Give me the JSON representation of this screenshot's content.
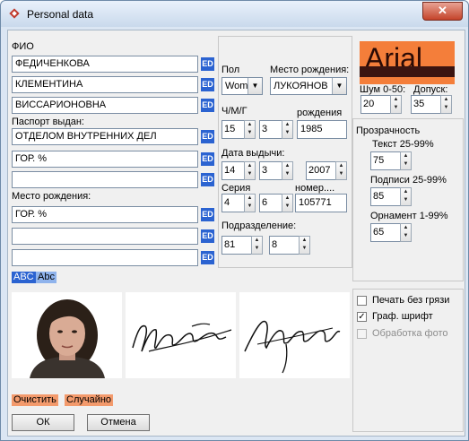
{
  "window": {
    "title": "Personal data",
    "close_label": "✕"
  },
  "fio": {
    "label": "ФИО",
    "surname": "ФЕДИЧЕНКОВА",
    "name": "КЛЕМЕНТИНА",
    "patronymic": "ВИССАРИОНОВНА",
    "ed_label": "ED"
  },
  "passport": {
    "label": "Паспорт выдан:",
    "line1": "ОТДЕЛОМ ВНУТРЕННИХ ДЕЛ",
    "line2": "ГОР. %",
    "line3": ""
  },
  "birthplace": {
    "label": "Место рождения:",
    "line1": "ГОР. %",
    "line2": "",
    "line3": ""
  },
  "case_buttons": {
    "upper": "ABC",
    "mixed": "Abc"
  },
  "middle": {
    "sex_label": "Пол",
    "sex_value": "Wom",
    "birthplace_label": "Место рождения:",
    "birthplace_value": "ЛУКОЯНОВ",
    "dmy_label": "Ч/М/Г",
    "birth_label": "рождения",
    "birth_day": "15",
    "birth_month": "3",
    "birth_year": "1985",
    "issue_label": "Дата выдычи:",
    "issue_day": "14",
    "issue_month": "3",
    "issue_year": "2007",
    "series_label": "Серия",
    "number_label": "номер....",
    "series_1": "4",
    "series_2": "6",
    "number": "105771",
    "division_label": "Подразделение:",
    "division_1": "81",
    "division_2": "8"
  },
  "font_preview": {
    "text": "Arial"
  },
  "noise": {
    "noise_label": "Шум 0-50:",
    "tolerance_label": "Допуск:",
    "noise_value": "20",
    "tolerance_value": "35"
  },
  "transparency": {
    "title": "Прозрачность",
    "text_label": "Текст 25-99%",
    "text_value": "75",
    "signature_label": "Подписи 25-99%",
    "signature_value": "85",
    "ornament_label": "Орнамент 1-99%",
    "ornament_value": "65"
  },
  "options": {
    "clean_print": "Печать без грязи",
    "graph_font": "Граф. шрифт",
    "photo_processing": "Обработка фото"
  },
  "actions": {
    "clear": "Очистить",
    "random": "Случайно"
  },
  "footer": {
    "ok": "ОК",
    "cancel": "Отмена"
  },
  "colors": {
    "accent_orange": "#f39a6c",
    "ed_blue": "#2b63d1",
    "preview_bg": "#f47e3a",
    "preview_bar": "#3b1410"
  }
}
